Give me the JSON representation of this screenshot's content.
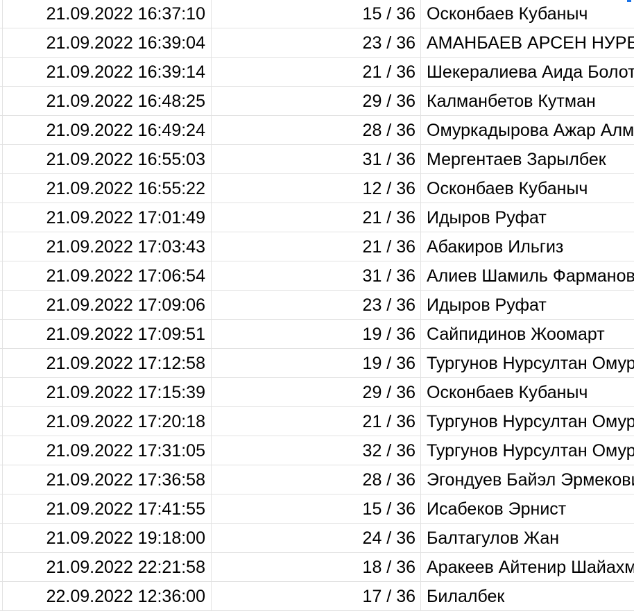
{
  "sheet": {
    "rows": [
      {
        "timestamp": "21.09.2022 16:37:10",
        "score": "15 / 36",
        "name": "Осконбаев Кубаныч"
      },
      {
        "timestamp": "21.09.2022 16:39:04",
        "score": "23 / 36",
        "name": "АМАНБАЕВ АРСЕН НУРБЕКОВИЧ"
      },
      {
        "timestamp": "21.09.2022 16:39:14",
        "score": "21 / 36",
        "name": "Шекералиева Аида Болотбековна"
      },
      {
        "timestamp": "21.09.2022 16:48:25",
        "score": "29 / 36",
        "name": "Калманбетов Кутман"
      },
      {
        "timestamp": "21.09.2022 16:49:24",
        "score": "28 / 36",
        "name": "Омуркадырова Ажар Алмазбековна"
      },
      {
        "timestamp": "21.09.2022 16:55:03",
        "score": "31 / 36",
        "name": "Мергентаев Зарылбек"
      },
      {
        "timestamp": "21.09.2022 16:55:22",
        "score": "12 / 36",
        "name": "Осконбаев Кубаныч"
      },
      {
        "timestamp": "21.09.2022 17:01:49",
        "score": "21 / 36",
        "name": "Идыров Руфат"
      },
      {
        "timestamp": "21.09.2022 17:03:43",
        "score": "21 / 36",
        "name": "Абакиров Ильгиз"
      },
      {
        "timestamp": "21.09.2022 17:06:54",
        "score": "31 / 36",
        "name": "Алиев Шамиль Фарманович"
      },
      {
        "timestamp": "21.09.2022 17:09:06",
        "score": "23 / 36",
        "name": "Идыров Руфат"
      },
      {
        "timestamp": "21.09.2022 17:09:51",
        "score": "19 / 36",
        "name": "Сайпидинов Жоомарт"
      },
      {
        "timestamp": "21.09.2022 17:12:58",
        "score": "19 / 36",
        "name": "Тургунов Нурсултан Омурбекович"
      },
      {
        "timestamp": "21.09.2022 17:15:39",
        "score": "29 / 36",
        "name": "Осконбаев Кубаныч"
      },
      {
        "timestamp": "21.09.2022 17:20:18",
        "score": "21 / 36",
        "name": "Тургунов Нурсултан Омурбекович"
      },
      {
        "timestamp": "21.09.2022 17:31:05",
        "score": "32 / 36",
        "name": "Тургунов Нурсултан Омурбекович"
      },
      {
        "timestamp": "21.09.2022 17:36:58",
        "score": "28 / 36",
        "name": "Эгондуев Байэл Эрмекович"
      },
      {
        "timestamp": "21.09.2022 17:41:55",
        "score": "15 / 36",
        "name": "Исабеков Эрнист"
      },
      {
        "timestamp": "21.09.2022 19:18:00",
        "score": "24 / 36",
        "name": "Балтагулов Жан"
      },
      {
        "timestamp": "21.09.2022 22:21:58",
        "score": "18 / 36",
        "name": "Аракеев Айтенир Шайахметович"
      },
      {
        "timestamp": "22.09.2022 12:36:00",
        "score": "17 / 36",
        "name": "Билалбек"
      }
    ]
  },
  "colors": {
    "gridline": "#e2e2e2",
    "selection_handle": "#1a73e8",
    "text": "#000000",
    "background": "#ffffff"
  }
}
